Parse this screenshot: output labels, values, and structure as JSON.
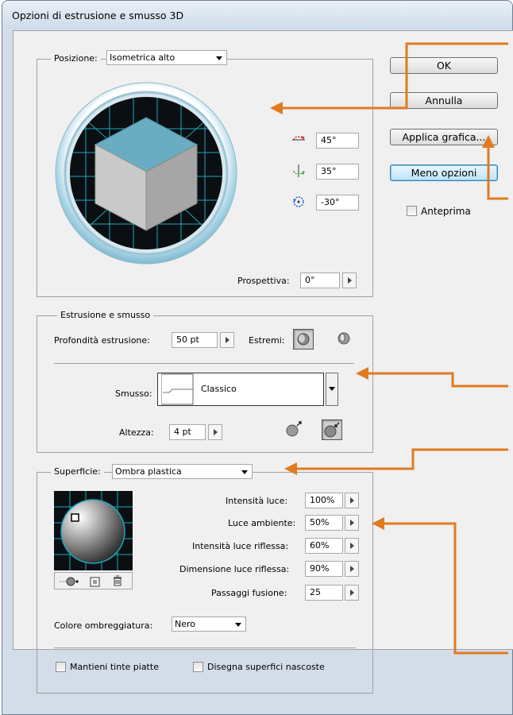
{
  "window": {
    "title": "Opzioni di estrusione e smusso 3D"
  },
  "position": {
    "label": "Posizione:",
    "preset": "Isometrica alto",
    "rot_x": "45°",
    "rot_y": "35°",
    "rot_z": "-30°",
    "perspective_label": "Prospettiva:",
    "perspective": "0°"
  },
  "extrude": {
    "group_label": "Estrusione e smusso",
    "depth_label": "Profondità estrusione:",
    "depth": "50 pt",
    "caps_label": "Estremi:",
    "bevel_label": "Smusso:",
    "bevel": "Classico",
    "height_label": "Altezza:",
    "height": "4 pt"
  },
  "surface": {
    "label": "Superficie:",
    "type": "Ombra plastica",
    "light_intensity_label": "Intensità luce:",
    "light_intensity": "100%",
    "ambient_label": "Luce ambiente:",
    "ambient": "50%",
    "highlight_intensity_label": "Intensità luce riflessa:",
    "highlight_intensity": "60%",
    "highlight_size_label": "Dimensione luce riflessa:",
    "highlight_size": "90%",
    "blend_steps_label": "Passaggi fusione:",
    "blend_steps": "25",
    "shading_color_label": "Colore ombreggiatura:",
    "shading_color": "Nero",
    "preserve_spot_label": "Mantieni tinte piatte",
    "draw_hidden_label": "Disegna superfici nascoste"
  },
  "buttons": {
    "ok": "OK",
    "cancel": "Annulla",
    "map_art": "Applica grafica...",
    "fewer_options": "Meno opzioni",
    "preview": "Anteprima"
  },
  "colors": {
    "annotation_arrow": "#e07b1f",
    "cube_top": "#6aacc1",
    "focus_button": "#bfe4f9"
  }
}
